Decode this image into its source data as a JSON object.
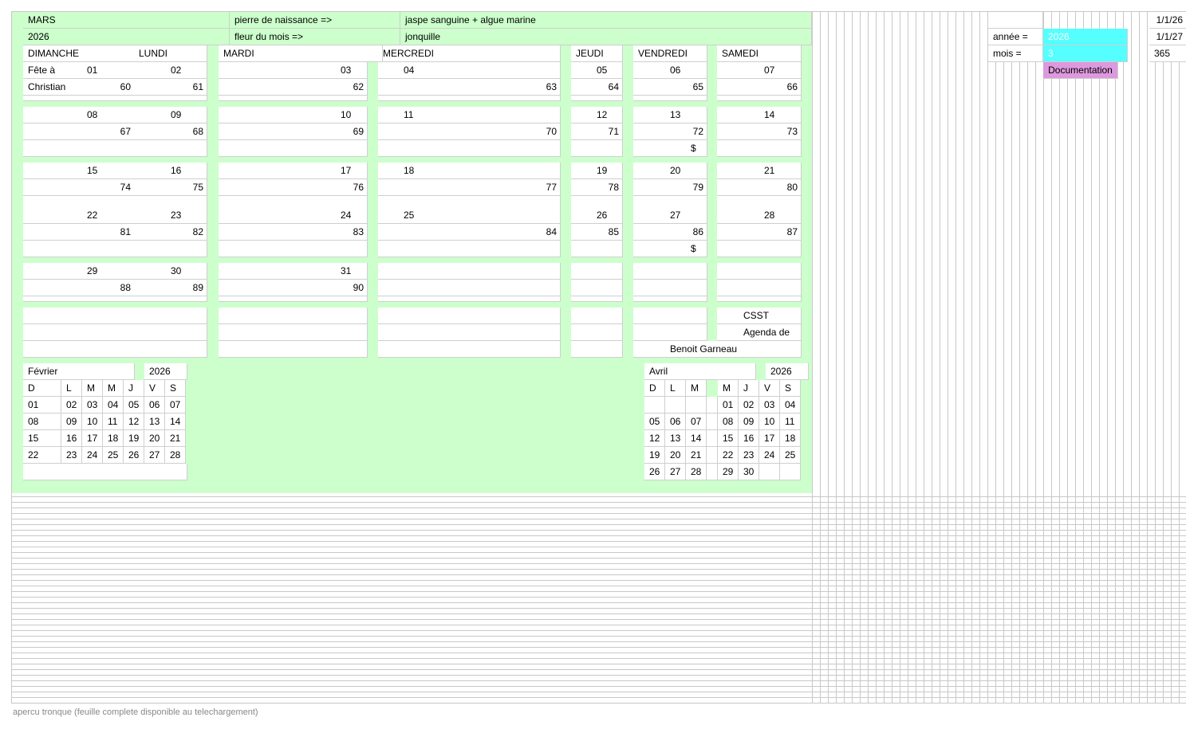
{
  "header": {
    "month": "MARS",
    "year": "2026",
    "stone_label": "pierre de naissance =>",
    "stone_value": "jaspe sanguine + algue marine",
    "flower_label": "fleur du mois =>",
    "flower_value": "jonquille"
  },
  "days": [
    "DIMANCHE",
    "LUNDI",
    "MARDI",
    "MERCREDI",
    "JEUDI",
    "VENDREDI",
    "SAMEDI"
  ],
  "feast": {
    "line1": "Fête à",
    "line2": "Christian"
  },
  "weeks": [
    {
      "dates": [
        "01",
        "02",
        "03",
        "04",
        "05",
        "06",
        "07"
      ],
      "ords": [
        "60",
        "61",
        "62",
        "63",
        "64",
        "65",
        "66"
      ]
    },
    {
      "dates": [
        "08",
        "09",
        "10",
        "11",
        "12",
        "13",
        "14"
      ],
      "ords": [
        "67",
        "68",
        "69",
        "70",
        "71",
        "72",
        "73"
      ]
    },
    {
      "dates": [
        "15",
        "16",
        "17",
        "18",
        "19",
        "20",
        "21"
      ],
      "ords": [
        "74",
        "75",
        "76",
        "77",
        "78",
        "79",
        "80"
      ]
    },
    {
      "dates": [
        "22",
        "23",
        "24",
        "25",
        "26",
        "27",
        "28"
      ],
      "ords": [
        "81",
        "82",
        "83",
        "84",
        "85",
        "86",
        "87"
      ]
    },
    {
      "dates": [
        "29",
        "30",
        "31",
        "",
        "",
        "",
        ""
      ],
      "ords": [
        "88",
        "89",
        "90",
        "",
        "",
        "",
        ""
      ]
    }
  ],
  "paydays": {
    "w2": "$",
    "w4": "$"
  },
  "org": {
    "line1": "CSST",
    "line2": "Agenda de",
    "name": "Benoit Garneau"
  },
  "prev_month": {
    "name": "Février",
    "year": "2026",
    "heads": [
      "D",
      "L",
      "M",
      "M",
      "J",
      "V",
      "S"
    ],
    "rows": [
      [
        "01",
        "02",
        "03",
        "04",
        "05",
        "06",
        "07"
      ],
      [
        "08",
        "09",
        "10",
        "11",
        "12",
        "13",
        "14"
      ],
      [
        "15",
        "16",
        "17",
        "18",
        "19",
        "20",
        "21"
      ],
      [
        "22",
        "23",
        "24",
        "25",
        "26",
        "27",
        "28"
      ]
    ]
  },
  "next_month": {
    "name": "Avril",
    "year": "2026",
    "heads": [
      "D",
      "L",
      "M",
      "M",
      "J",
      "V",
      "S"
    ],
    "rows": [
      [
        "",
        "",
        "",
        "",
        "01",
        "02",
        "03",
        "04"
      ],
      [
        "05",
        "06",
        "07",
        "",
        "08",
        "09",
        "10",
        "11"
      ],
      [
        "12",
        "13",
        "14",
        "",
        "15",
        "16",
        "17",
        "18"
      ],
      [
        "19",
        "20",
        "21",
        "",
        "22",
        "23",
        "24",
        "25"
      ],
      [
        "26",
        "27",
        "28",
        "",
        "29",
        "30",
        "",
        ""
      ]
    ]
  },
  "side": {
    "date1": "1/1/26",
    "date2": "1/1/27",
    "days_in_year": "365",
    "year_label": "année =",
    "year_value": "2026",
    "month_label": "mois =",
    "month_value": "3",
    "doc_button": "Documentation"
  },
  "footer": "apercu tronque (feuille complete disponible au telechargement)",
  "colors": {
    "green": "#ccffcc",
    "cyan": "#55ffff",
    "pink": "#dd99dd"
  }
}
